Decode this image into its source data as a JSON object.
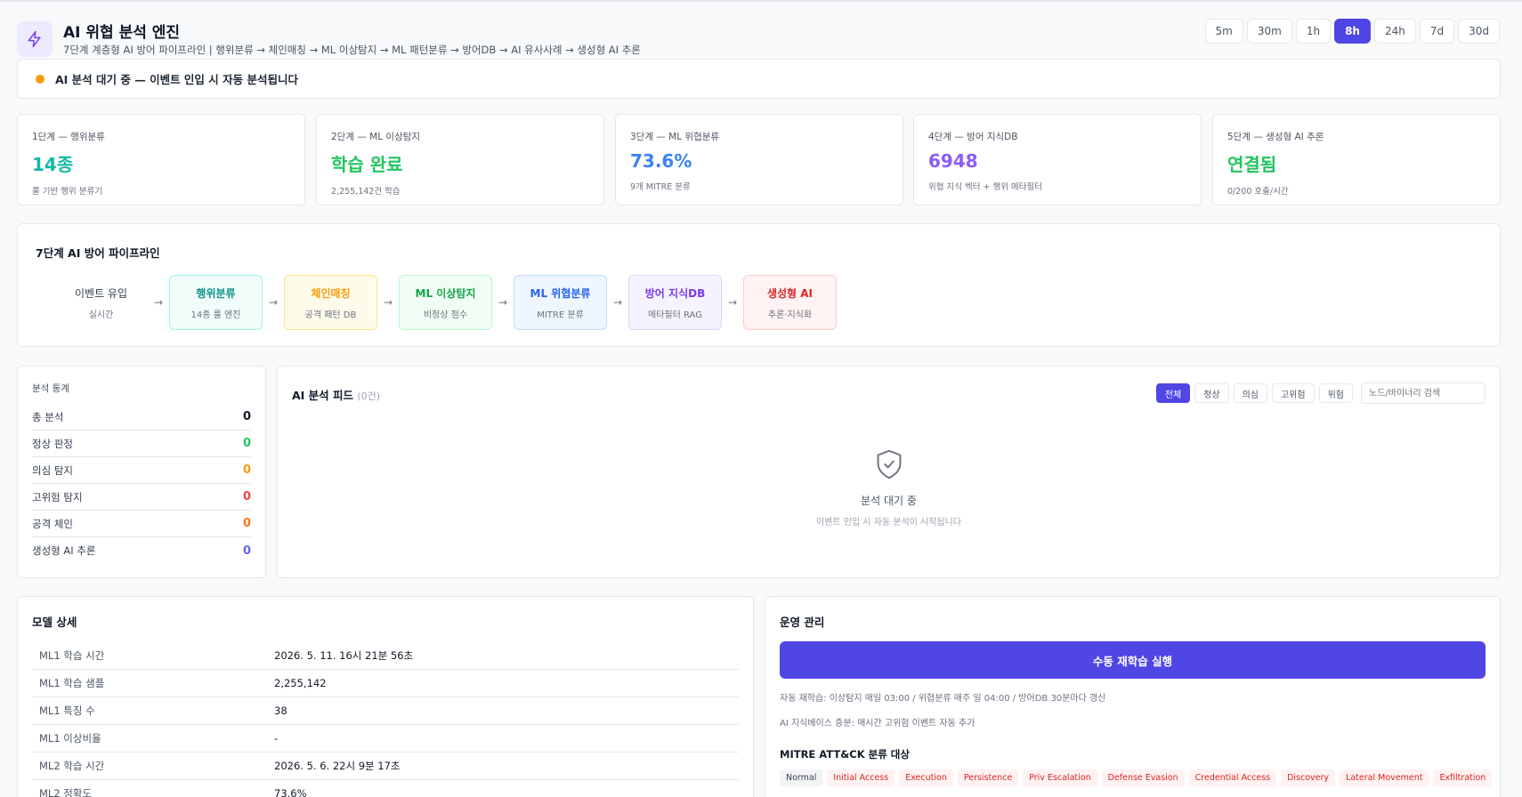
{
  "header": {
    "title": "AI 위협 분석 엔진",
    "subtitle": "7단계 계층형 AI 방어 파이프라인 | 행위분류 → 체인매칭 → ML 이상탐지 → ML 패턴분류 → 방어DB → AI 유사사례 → 생성형 AI 추론",
    "icon": "lightning-icon",
    "time_ranges": [
      "5m",
      "30m",
      "1h",
      "8h",
      "24h",
      "7d",
      "30d"
    ],
    "active_range": "8h"
  },
  "banner": {
    "text": "AI 분석 대기 중 — 이벤트 인입 시 자동 분석됩니다",
    "status_color": "#f59e0b"
  },
  "stats": [
    {
      "label": "1단계 — 행위분류",
      "value": "14종",
      "note": "룰 기반 행위 분류기",
      "color": "#14b8a6"
    },
    {
      "label": "2단계 — ML 이상탐지",
      "value": "학습 완료",
      "note": "2,255,142건 학습",
      "color": "#22c55e"
    },
    {
      "label": "3단계 — ML 위협분류",
      "value": "73.6%",
      "note": "9개 MITRE 분류",
      "color": "#3b82f6"
    },
    {
      "label": "4단계 — 방어 지식DB",
      "value": "6948",
      "note": "위협 지식 벡터 + 행위 메타필터",
      "color": "#8b5cf6"
    },
    {
      "label": "5단계 — 생성형 AI 추론",
      "value": "연결됨",
      "note": "0/200 호출/시간",
      "color": "#22c55e"
    }
  ],
  "pipeline": {
    "title": "7단계 AI 방어 파이프라인",
    "source": {
      "name": "이벤트 유입",
      "sub": "실시간"
    },
    "stages": [
      {
        "name": "행위분류",
        "sub": "14종 룰 엔진",
        "color": "#0d9488",
        "bg": "#f0fdfa",
        "border": "#99f6e4"
      },
      {
        "name": "체인매칭",
        "sub": "공격 패턴 DB",
        "color": "#f59e0b",
        "bg": "#fffbeb",
        "border": "#fde68a"
      },
      {
        "name": "ML 이상탐지",
        "sub": "비정상 점수",
        "color": "#16a34a",
        "bg": "#f0fdf4",
        "border": "#bbf7d0"
      },
      {
        "name": "ML 위협분류",
        "sub": "MITRE 분류",
        "color": "#2563eb",
        "bg": "#eff6ff",
        "border": "#bfdbfe"
      },
      {
        "name": "방어 지식DB",
        "sub": "메타필터 RAG",
        "color": "#7c3aed",
        "bg": "#f5f3ff",
        "border": "#ddd6fe"
      },
      {
        "name": "생성형 AI",
        "sub": "추론·지식화",
        "color": "#dc2626",
        "bg": "#fef2f2",
        "border": "#fecaca"
      }
    ]
  },
  "analysis_stats": {
    "title": "분석 통계",
    "rows": [
      {
        "label": "총 분석",
        "value": "0",
        "color": "#111827"
      },
      {
        "label": "정상 판정",
        "value": "0",
        "color": "#22c55e"
      },
      {
        "label": "의심 탐지",
        "value": "0",
        "color": "#f59e0b"
      },
      {
        "label": "고위험 탐지",
        "value": "0",
        "color": "#ef4444"
      },
      {
        "label": "공격 체인",
        "value": "0",
        "color": "#f97316"
      },
      {
        "label": "생성형 AI 추론",
        "value": "0",
        "color": "#6366f1"
      }
    ]
  },
  "feed": {
    "title": "AI 분석 피드",
    "count": "(0건)",
    "filters": [
      "전체",
      "정상",
      "의심",
      "고위험",
      "위험"
    ],
    "active_filter": "전체",
    "search_placeholder": "노드/바이너리 검색",
    "empty_icon": "shield-check-icon",
    "empty_title": "분석 대기 중",
    "empty_sub": "이벤트 인입 시 자동 분석이 시작됩니다"
  },
  "model": {
    "title": "모델 상세",
    "rows": [
      {
        "key": "ML1 학습 시간",
        "value": "2026. 5. 11. 16시 21분 56초"
      },
      {
        "key": "ML1 학습 샘플",
        "value": "2,255,142"
      },
      {
        "key": "ML1 특징 수",
        "value": "38"
      },
      {
        "key": "ML1 이상비율",
        "value": "-"
      },
      {
        "key": "ML2 학습 시간",
        "value": "2026. 5. 6. 22시 9분 17초"
      },
      {
        "key": "ML2 정확도",
        "value": "73.6%"
      }
    ]
  },
  "ops": {
    "title": "운영 관리",
    "retrain_label": "수동 재학습 실행",
    "note1": "자동 재학습: 이상탐지 매일 03:00 / 위협분류 매주 일 04:00 / 방어DB 30분마다 갱신",
    "note2": "AI 지식베이스 증분: 매시간 고위험 이벤트 자동 추가",
    "mitre_title": "MITRE ATT&CK 분류 대상",
    "tags": [
      "Normal",
      "Initial Access",
      "Execution",
      "Persistence",
      "Priv Escalation",
      "Defense Evasion",
      "Credential Access",
      "Discovery",
      "Lateral Movement",
      "Exfiltration"
    ]
  }
}
